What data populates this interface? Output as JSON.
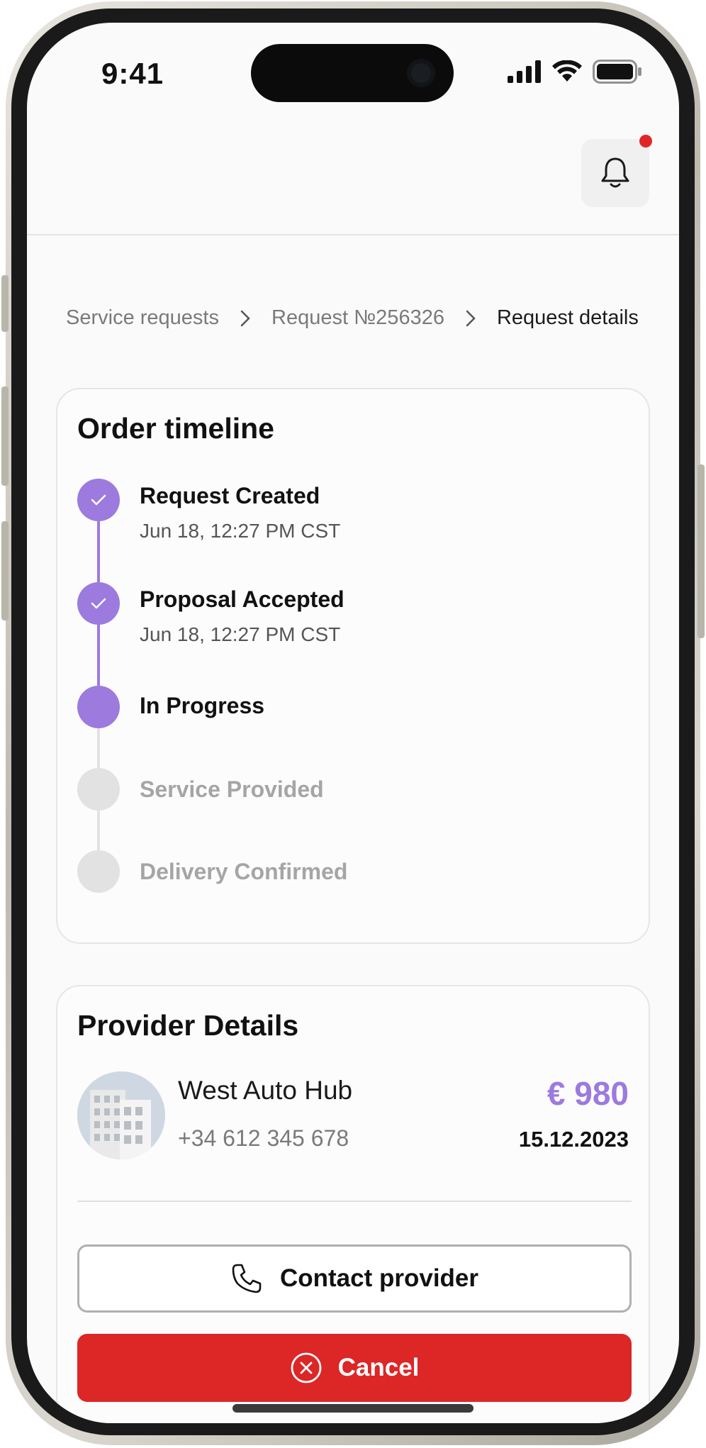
{
  "status_bar": {
    "time": "9:41"
  },
  "header": {
    "notification_icon": "bell-icon",
    "has_unread": true
  },
  "breadcrumb": [
    {
      "label": "Service requests"
    },
    {
      "label": "Request №256326"
    },
    {
      "label": "Request details"
    }
  ],
  "timeline": {
    "title": "Order timeline",
    "steps": [
      {
        "label": "Request Created",
        "date": "Jun 18, 12:27 PM CST",
        "state": "done"
      },
      {
        "label": "Proposal Accepted",
        "date": "Jun 18, 12:27 PM CST",
        "state": "done"
      },
      {
        "label": "In Progress",
        "state": "current"
      },
      {
        "label": "Service Provided",
        "state": "pending"
      },
      {
        "label": "Delivery Confirmed",
        "state": "pending"
      }
    ]
  },
  "provider": {
    "title": "Provider Details",
    "name": "West Auto Hub",
    "phone": "+34 612 345 678",
    "price": "€ 980",
    "date": "15.12.2023",
    "contact_label": "Contact provider",
    "cancel_label": "Cancel"
  },
  "colors": {
    "accent": "#9c7ade",
    "danger": "#dd2626",
    "pending": "#e2e2e2"
  }
}
